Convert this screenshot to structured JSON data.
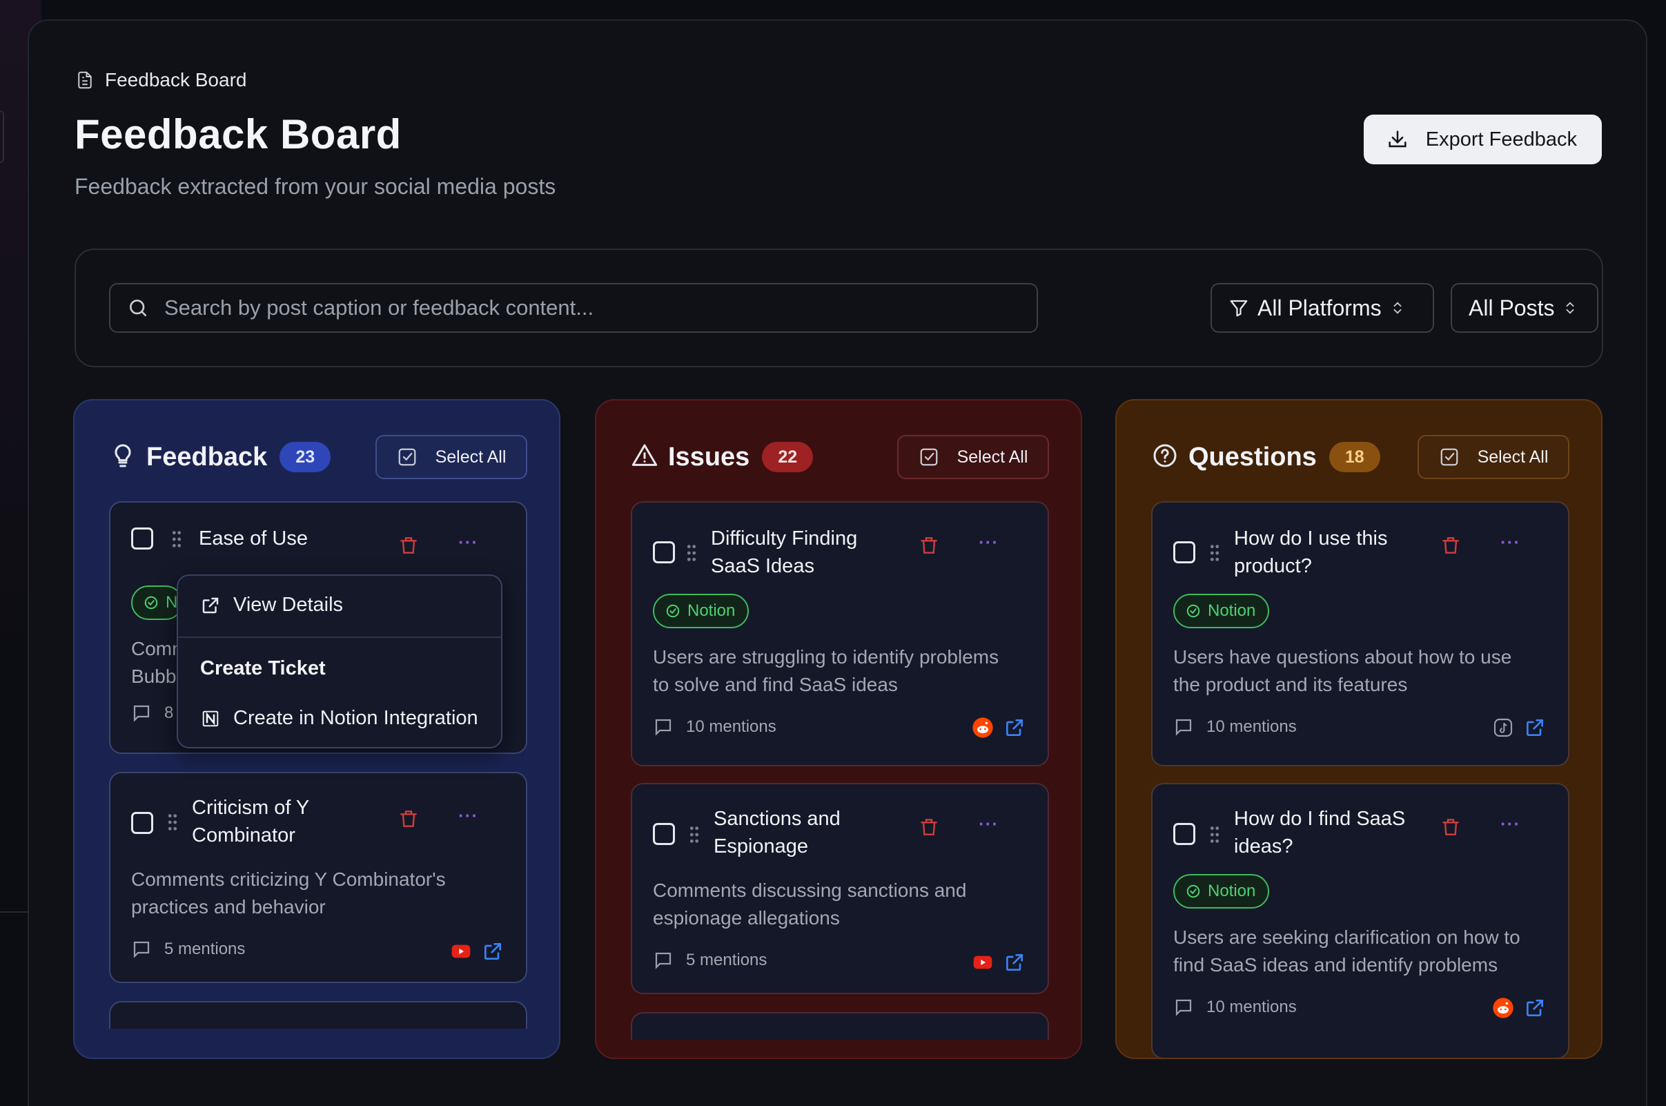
{
  "breadcrumb": {
    "label": "Feedback Board",
    "icon": "document-icon"
  },
  "header": {
    "title": "Feedback Board",
    "subtitle": "Feedback extracted from your social media posts",
    "export_label": "Export Feedback"
  },
  "filters": {
    "search_placeholder": "Search by post caption or feedback content...",
    "platform_select": "All Platforms",
    "posts_select": "All Posts"
  },
  "columns": {
    "feedback": {
      "title": "Feedback",
      "count": "23",
      "select_all": "Select All",
      "accent": "#2f46b8",
      "cards": [
        {
          "title": "Ease of Use",
          "tag": "N",
          "desc_partial": [
            "Comm",
            "Bubb"
          ],
          "mentions_partial": "8"
        },
        {
          "title_lines": [
            "Criticism of Y",
            "Combinator"
          ],
          "desc_lines": [
            "Comments criticizing Y Combinator's",
            "practices and behavior"
          ],
          "mentions": "5 mentions",
          "platform": "youtube"
        }
      ]
    },
    "issues": {
      "title": "Issues",
      "count": "22",
      "select_all": "Select All",
      "accent": "#9e2124",
      "cards": [
        {
          "title_lines": [
            "Difficulty Finding",
            "SaaS Ideas"
          ],
          "tag": "Notion",
          "desc_lines": [
            "Users are struggling to identify problems",
            "to solve and find SaaS ideas"
          ],
          "mentions": "10 mentions",
          "platform": "reddit"
        },
        {
          "title_lines": [
            "Sanctions and",
            "Espionage"
          ],
          "desc_lines": [
            "Comments discussing sanctions and",
            "espionage allegations"
          ],
          "mentions": "5 mentions",
          "platform": "youtube"
        }
      ]
    },
    "questions": {
      "title": "Questions",
      "count": "18",
      "select_all": "Select All",
      "accent": "#8a5010",
      "cards": [
        {
          "title_lines": [
            "How do I use this",
            "product?"
          ],
          "tag": "Notion",
          "desc_lines": [
            "Users have questions about how to use",
            "the product and its features"
          ],
          "mentions": "10 mentions",
          "platform": "tiktok"
        },
        {
          "title_lines": [
            "How do I find SaaS",
            "ideas?"
          ],
          "tag": "Notion",
          "desc_lines": [
            "Users are seeking clarification on how to",
            "find SaaS ideas and identify problems"
          ],
          "mentions": "10 mentions",
          "platform": "reddit"
        }
      ]
    }
  },
  "context_menu": {
    "view_details": "View Details",
    "section_title": "Create Ticket",
    "create_notion": "Create in Notion Integration"
  },
  "card_more_label": "···"
}
